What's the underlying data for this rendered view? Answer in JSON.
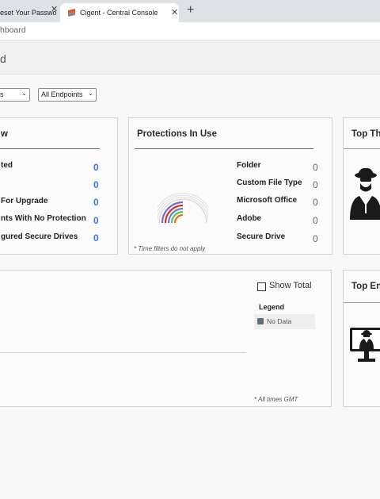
{
  "browser": {
    "tabs": [
      {
        "label": "eset Your Passwo"
      },
      {
        "label": "Cigent - Central Console"
      }
    ],
    "address": "hboard"
  },
  "page": {
    "title": "d"
  },
  "filters": {
    "first": "s",
    "endpoints": "All Endpoints"
  },
  "overview_card": {
    "title": "w",
    "rows": [
      {
        "label": "ted",
        "value": "0"
      },
      {
        "label": "",
        "value": "0"
      },
      {
        "label": "For Upgrade",
        "value": "0"
      },
      {
        "label": "nts With No Protection",
        "value": "0"
      },
      {
        "label": "gured Secure Drives",
        "value": "0"
      }
    ]
  },
  "protections_card": {
    "title": "Protections In Use",
    "rows": [
      {
        "label": "Folder",
        "value": "0"
      },
      {
        "label": "Custom File Type",
        "value": "0"
      },
      {
        "label": "Microsoft Office",
        "value": "0"
      },
      {
        "label": "Adobe",
        "value": "0"
      },
      {
        "label": "Secure Drive",
        "value": "0"
      }
    ],
    "note": "* Time filters do not apply",
    "ring_colors": [
      "#e2712a",
      "#7db843",
      "#3b8fd4",
      "#cc3333",
      "#8e5ec4",
      "#d8d8d8"
    ]
  },
  "threats_card": {
    "title": "Top Th",
    "icon": "spy-icon"
  },
  "activity_card": {
    "show_total_label": "Show Total",
    "show_total_checked": false,
    "legend_title": "Legend",
    "legend_item": "No Data",
    "legend_color": "#5e6e7a",
    "note": "* All times GMT"
  },
  "endpoints_card": {
    "title": "Top En",
    "icon": "monitor-spy-icon"
  }
}
